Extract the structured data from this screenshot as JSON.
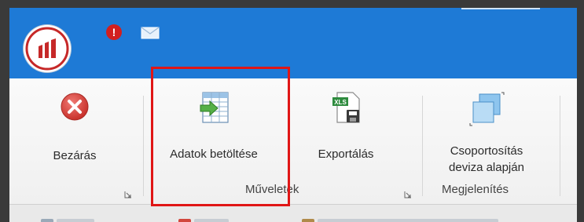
{
  "titlebar": {
    "alert_glyph": "!",
    "icons": [
      "app-logo",
      "alert-icon",
      "mail-icon"
    ],
    "colors": {
      "titlebar": "#1e7ad6",
      "logo_red": "#c62828",
      "highlight": "#e01616"
    }
  },
  "ribbon": {
    "buttons": {
      "close": {
        "label": "Bezárás",
        "icon": "close-circle-icon"
      },
      "load": {
        "label": "Adatok betöltése",
        "icon": "table-import-icon"
      },
      "export": {
        "label": "Exportálás",
        "icon": "xls-save-icon",
        "icon_text": "XLS"
      },
      "group_by_currency": {
        "label": "Csoportosítás\ndeviza alapján",
        "icon": "group-windows-icon"
      }
    },
    "groups": {
      "operations": "Műveletek",
      "view": "Megjelenítés"
    }
  }
}
